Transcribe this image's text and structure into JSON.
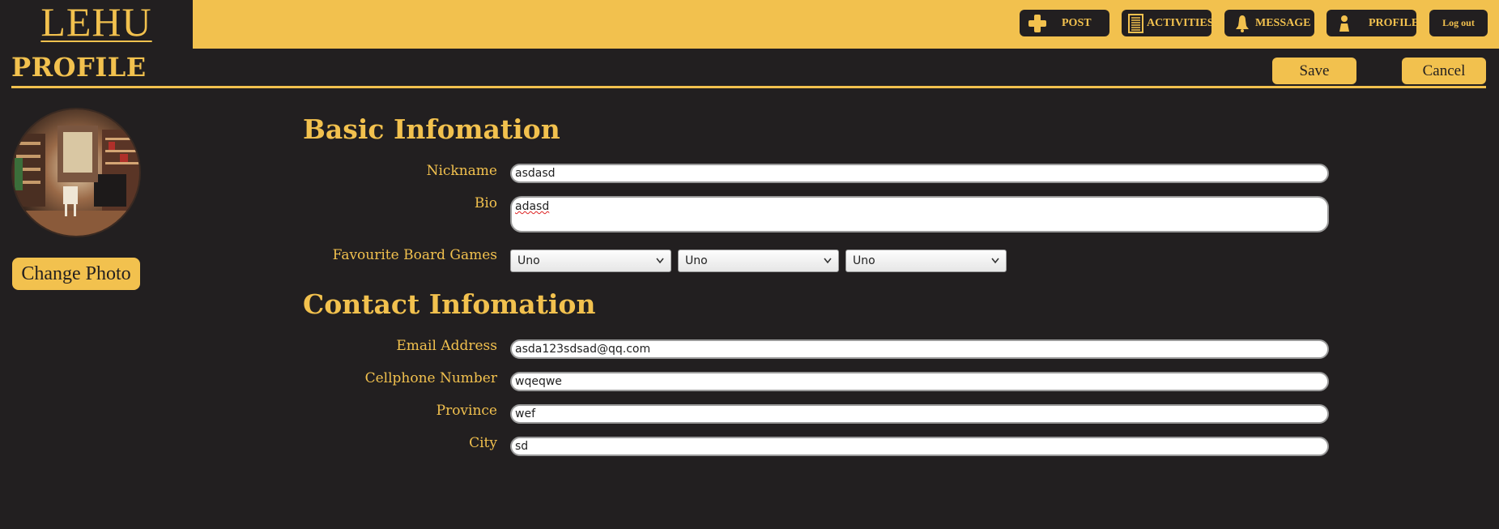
{
  "header": {
    "logo": "LEHU",
    "nav": [
      {
        "label": "POST",
        "icon": "plus-icon"
      },
      {
        "label": "ACTIVITIES",
        "icon": "list-icon"
      },
      {
        "label": "MESSAGE",
        "icon": "bell-icon"
      },
      {
        "label": "PROFILE",
        "icon": "user-icon"
      }
    ],
    "logout_label": "Log out"
  },
  "page": {
    "title": "PROFILE",
    "save_label": "Save",
    "cancel_label": "Cancel",
    "change_photo_label": "Change Photo"
  },
  "basic": {
    "title": "Basic Infomation",
    "nickname_label": "Nickname",
    "nickname_value": "asdasd",
    "bio_label": "Bio",
    "bio_value": "adasd",
    "games_label": "Favourite Board Games",
    "games": [
      "Uno",
      "Uno",
      "Uno"
    ]
  },
  "contact": {
    "title": "Contact Infomation",
    "email_label": "Email Address",
    "email_value": "asda123sdsad@qq.com",
    "phone_label": "Cellphone Number",
    "phone_value": "wqeqwe",
    "province_label": "Province",
    "province_value": "wef",
    "city_label": "City",
    "city_value": "sd"
  },
  "colors": {
    "background": "#221f20",
    "accent": "#f2c14e"
  }
}
